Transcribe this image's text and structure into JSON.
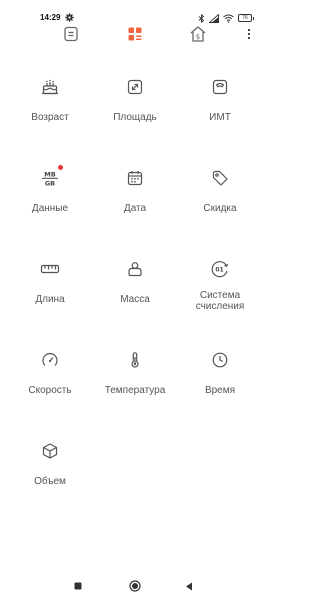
{
  "status": {
    "time": "14:29",
    "battery": "76"
  },
  "nav": {
    "active": "converter",
    "accent_color": "#f0643c",
    "icon_color": "#666666"
  },
  "converters": [
    {
      "label": "Возраст",
      "icon": "cake-icon"
    },
    {
      "label": "Площадь",
      "icon": "area-icon"
    },
    {
      "label": "ИМТ",
      "icon": "scale-icon"
    },
    {
      "label": "Данные",
      "icon": "data-icon",
      "badge_text": "MB GB",
      "has_new_dot": true
    },
    {
      "label": "Дата",
      "icon": "calendar-icon"
    },
    {
      "label": "Скидка",
      "icon": "tag-icon"
    },
    {
      "label": "Длина",
      "icon": "ruler-icon"
    },
    {
      "label": "Масса",
      "icon": "weight-icon"
    },
    {
      "label": "Система счисления",
      "icon": "numeral-system-icon",
      "icon_text": "01"
    },
    {
      "label": "Скорость",
      "icon": "speedometer-icon"
    },
    {
      "label": "Температура",
      "icon": "thermometer-icon"
    },
    {
      "label": "Время",
      "icon": "clock-icon"
    },
    {
      "label": "Объем",
      "icon": "volume-icon"
    }
  ]
}
